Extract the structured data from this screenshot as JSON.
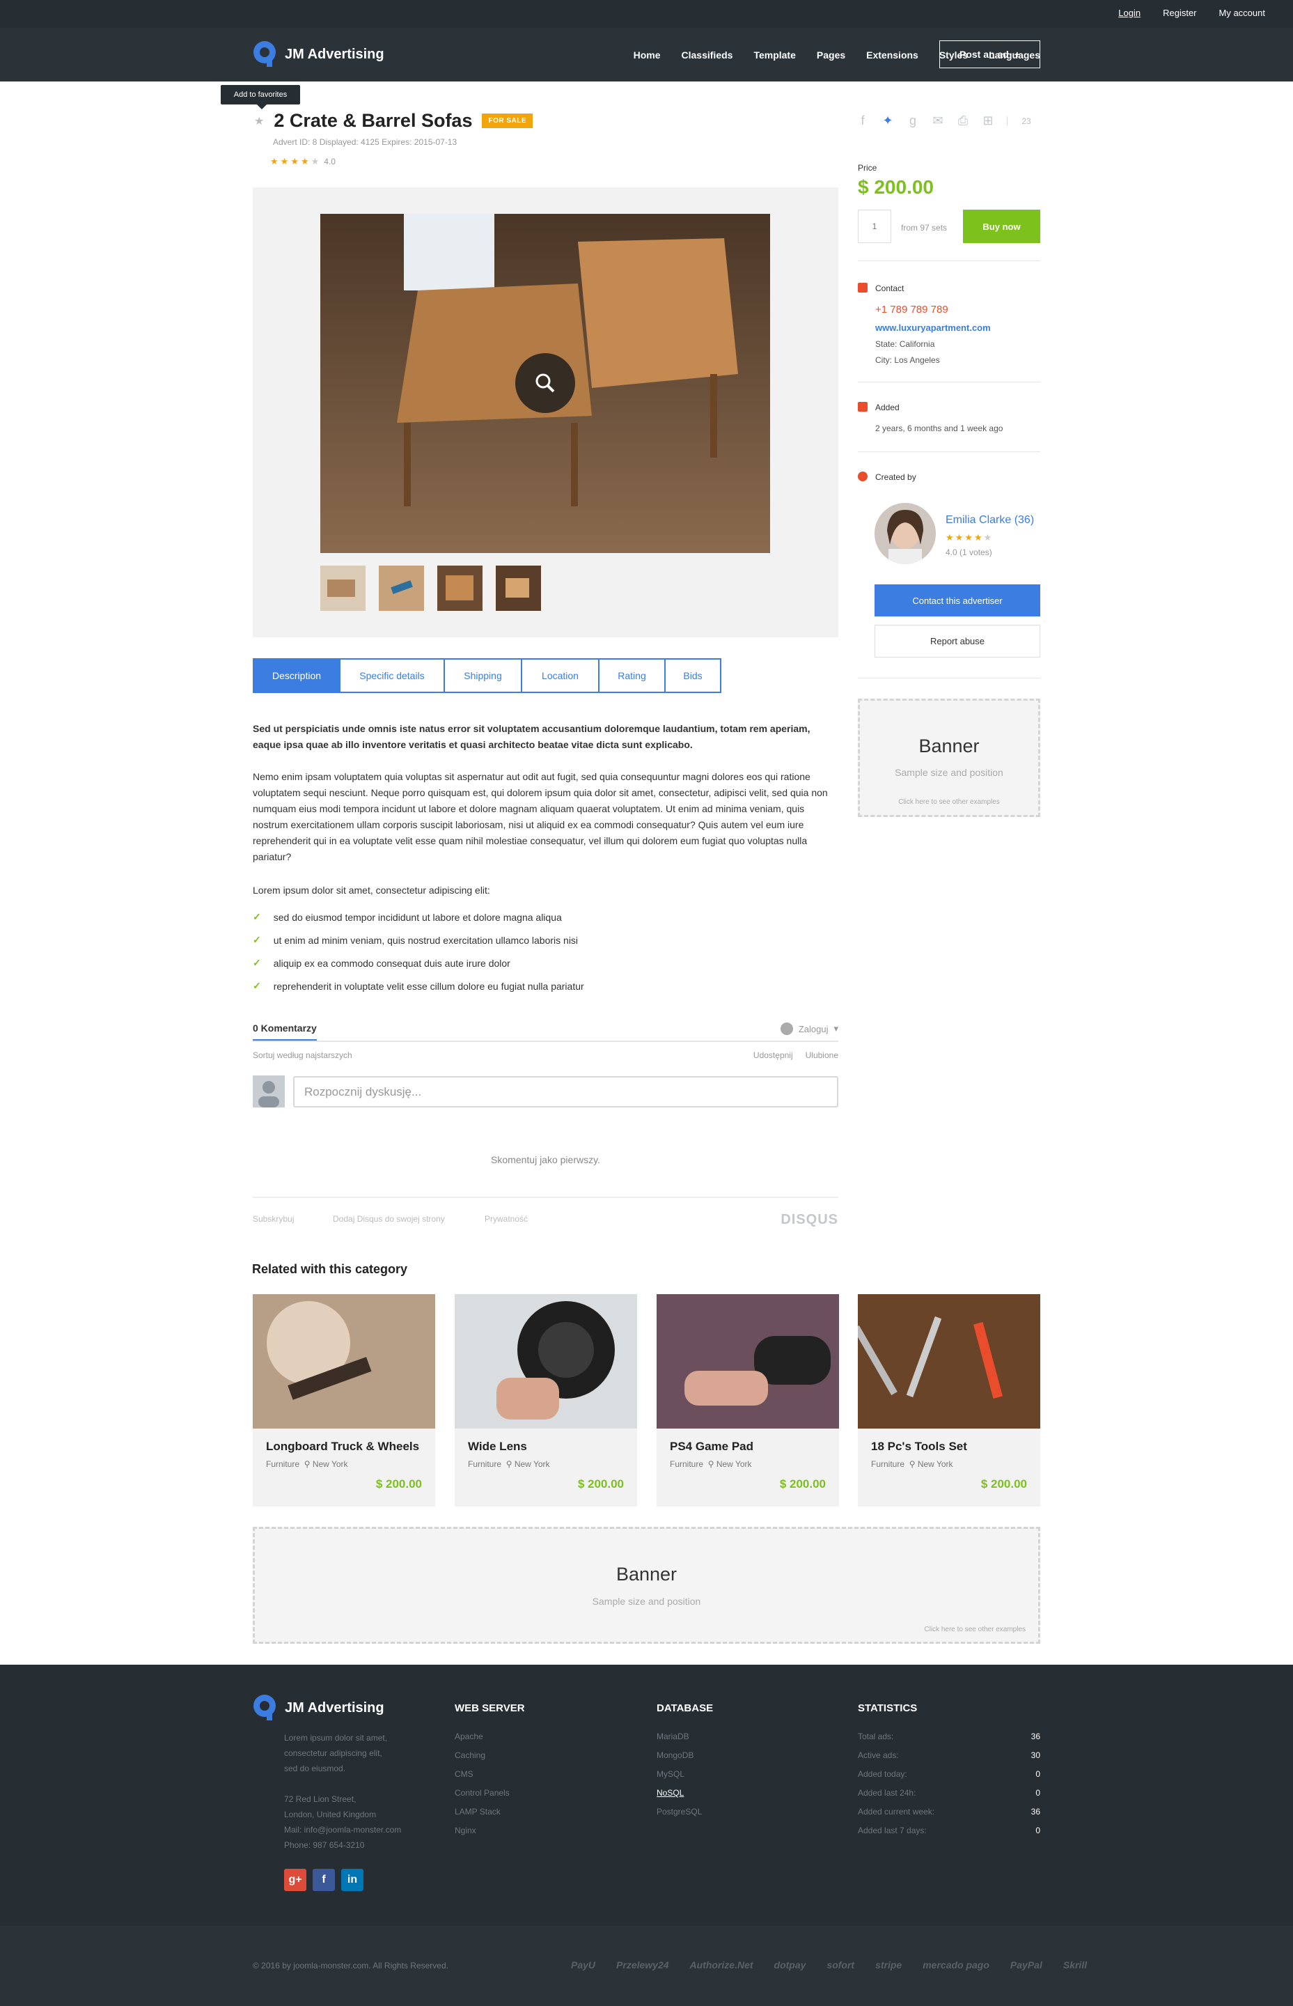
{
  "topbar": {
    "login": "Login",
    "register": "Register",
    "account": "My account"
  },
  "header": {
    "brand": "JM Advertising",
    "nav": [
      "Home",
      "Classifieds",
      "Template",
      "Pages",
      "Extensions",
      "Styles",
      "Languages"
    ],
    "post_ad": "Post an ad",
    "post_ad_icon": "+"
  },
  "tooltip": "Add to favorites",
  "advert": {
    "title": "2 Crate & Barrel Sofas",
    "badge": "FOR SALE",
    "meta": "Advert ID: 8 Displayed: 4125 Expires: 2015-07-13",
    "rating": "4.0",
    "stars": 4,
    "share_count": "23"
  },
  "tabs": [
    "Description",
    "Specific details",
    "Shipping",
    "Location",
    "Rating",
    "Bids"
  ],
  "description": {
    "lead": "Sed ut perspiciatis unde omnis iste natus error sit voluptatem accusantium doloremque laudantium, totam rem aperiam, eaque ipsa quae ab illo inventore veritatis et quasi architecto beatae vitae dicta sunt explicabo.",
    "body": "Nemo enim ipsam voluptatem quia voluptas sit aspernatur aut odit aut fugit, sed quia consequuntur magni dolores eos qui ratione voluptatem sequi nesciunt. Neque porro quisquam est, qui dolorem ipsum quia dolor sit amet, consectetur, adipisci velit, sed quia non numquam eius modi tempora incidunt ut labore et dolore magnam aliquam quaerat voluptatem. Ut enim ad minima veniam, quis nostrum exercitationem ullam corporis suscipit laboriosam, nisi ut aliquid ex ea commodi consequatur? Quis autem vel eum iure reprehenderit qui in ea voluptate velit esse quam nihil molestiae consequatur, vel illum qui dolorem eum fugiat quo voluptas nulla pariatur?",
    "list_intro": "Lorem ipsum dolor sit amet, consectetur adipiscing elit:",
    "bullets": [
      "sed do eiusmod tempor incididunt ut labore et dolore magna aliqua",
      "ut enim ad minim veniam, quis nostrud exercitation ullamco laboris nisi",
      "aliquip ex ea commodo consequat duis aute irure dolor",
      "reprehenderit in voluptate velit esse cillum dolore eu fugiat nulla pariatur"
    ]
  },
  "comments": {
    "count": "0 Komentarzy",
    "login": "Zaloguj",
    "sort": "Sortuj według najstarszych",
    "share": "Udostępnij",
    "favorite": "Ulubione",
    "placeholder": "Rozpocznij dyskusję...",
    "first": "Skomentuj jako pierwszy.",
    "subscribe": "Subskrybuj",
    "add_disqus": "Dodaj Disqus do swojej strony",
    "privacy": "Prywatność",
    "brand": "DISQUS"
  },
  "related": {
    "title": "Related with this category",
    "items": [
      {
        "name": "Longboard Truck & Wheels",
        "category": "Furniture",
        "location": "New York",
        "price": "$ 200.00"
      },
      {
        "name": "Wide Lens",
        "category": "Furniture",
        "location": "New York",
        "price": "$ 200.00"
      },
      {
        "name": "PS4 Game Pad",
        "category": "Furniture",
        "location": "New York",
        "price": "$ 200.00"
      },
      {
        "name": "18 Pc's Tools Set",
        "category": "Furniture",
        "location": "New York",
        "price": "$ 200.00"
      }
    ]
  },
  "banner": {
    "title": "Banner",
    "subtitle": "Sample size and position",
    "link": "Click here to see other examples"
  },
  "sidebar": {
    "price_label": "Price",
    "price": "$ 200.00",
    "qty": "1",
    "from": "from 97 sets",
    "buy": "Buy now",
    "contact_label": "Contact",
    "phone": "+1 789 789 789",
    "website": "www.luxuryapartment.com",
    "state": "State: California",
    "city": "City: Los Angeles",
    "added_label": "Added",
    "added_value": "2 years, 6 months and 1 week ago",
    "created_label": "Created by",
    "author": "Emilia Clarke (36)",
    "author_votes": "4.0 (1 votes)",
    "contact_btn": "Contact this advertiser",
    "report_btn": "Report abuse"
  },
  "footer": {
    "brand": "JM Advertising",
    "about": [
      "Lorem ipsum dolor sit amet,",
      "consectetur adipiscing elit,",
      "sed do eiusmod."
    ],
    "address": [
      "72 Red Lion Street,",
      "London,  United Kingdom",
      "Mail:  info@joomla-monster.com",
      "Phone:  987 654-3210"
    ],
    "web_title": "WEB SERVER",
    "web": [
      "Apache",
      "Caching",
      "CMS",
      "Control Panels",
      "LAMP Stack",
      "Nginx"
    ],
    "db_title": "DATABASE",
    "db": [
      "MariaDB",
      "MongoDB",
      "MySQL",
      "NoSQL",
      "PostgreSQL"
    ],
    "stats_title": "STATISTICS",
    "stats": [
      {
        "label": "Total ads:",
        "value": "36"
      },
      {
        "label": "Active ads:",
        "value": "30"
      },
      {
        "label": "Added today:",
        "value": "0"
      },
      {
        "label": "Added last 24h:",
        "value": "0"
      },
      {
        "label": "Added current week:",
        "value": "36"
      },
      {
        "label": "Added last 7 days:",
        "value": "0"
      }
    ],
    "social": [
      "g+",
      "f",
      "in"
    ],
    "copyright": "© 2016 by joomla-monster.com. All Rights Reserved.",
    "payments": [
      "PayU",
      "Przelewy24",
      "Authorize.Net",
      "dotpay",
      "sofort",
      "stripe",
      "mercado pago",
      "PayPal",
      "Skrill"
    ]
  },
  "colors": {
    "accent_blue": "#3b7de0",
    "accent_green": "#7dc11c",
    "badge_orange": "#f2a50b",
    "contact_red": "#e94d2c",
    "dark": "#262d33"
  }
}
